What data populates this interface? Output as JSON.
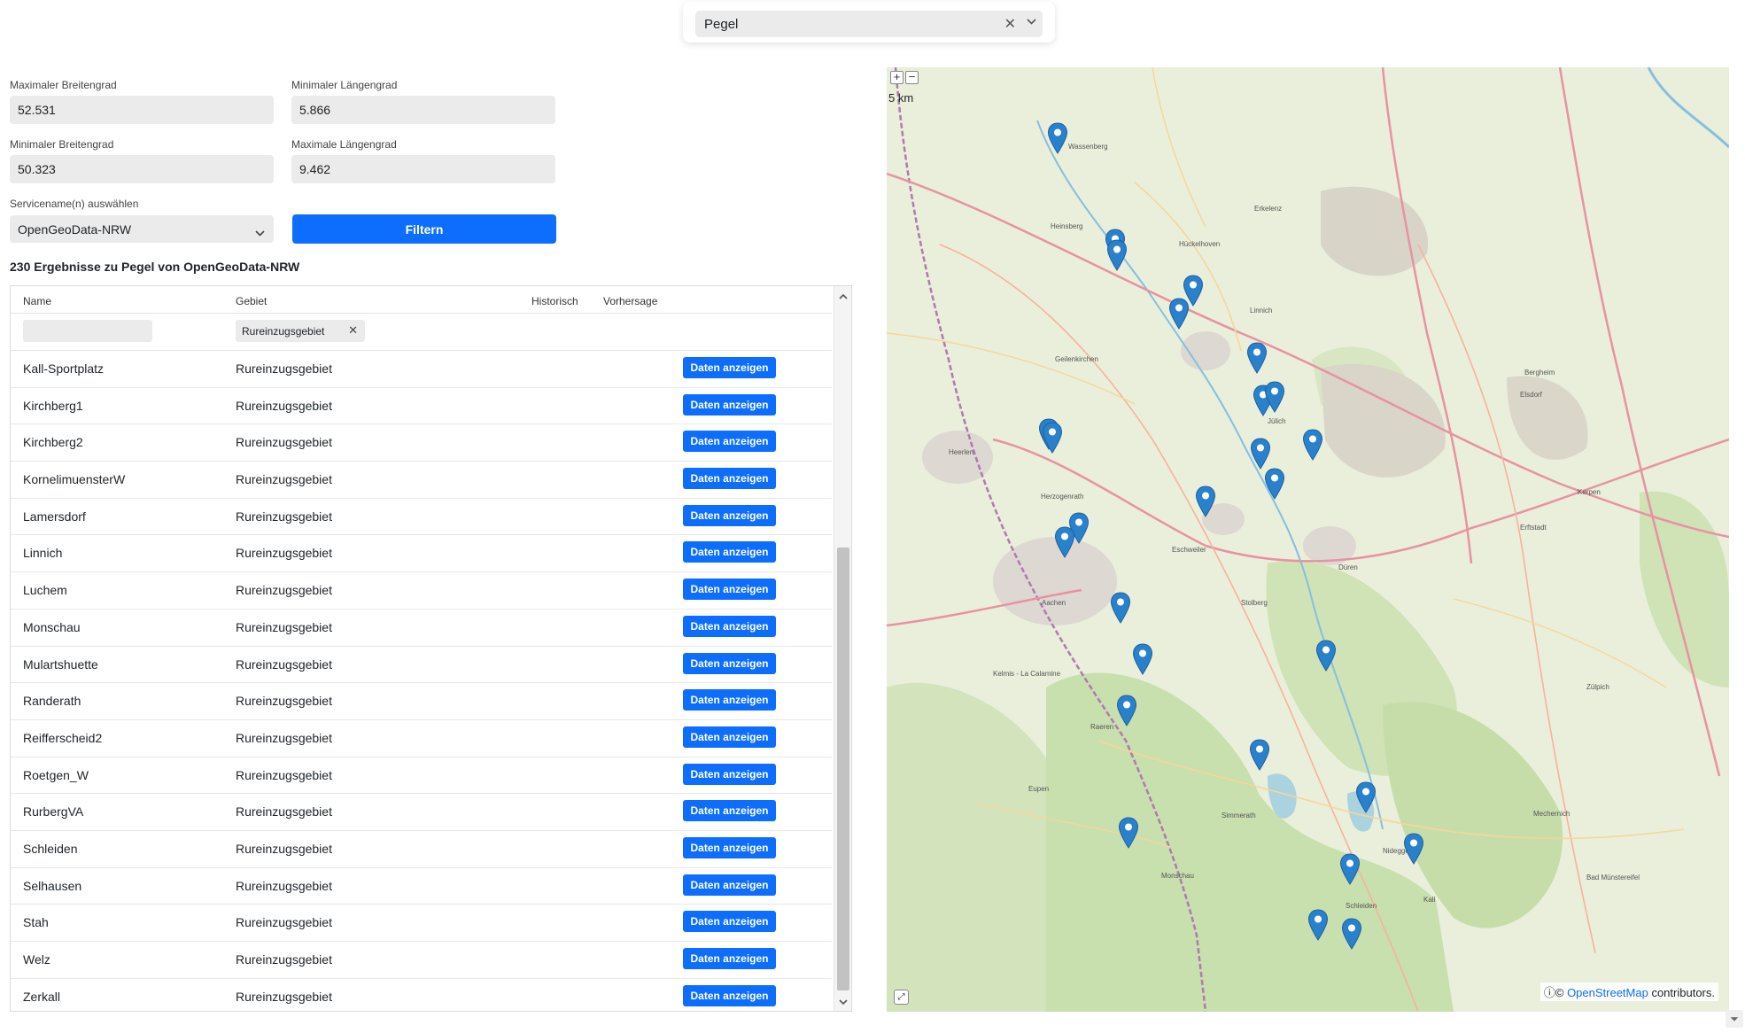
{
  "dataset_select": {
    "value": "Pegel",
    "clear_icon": "close-icon",
    "toggle_icon": "chevron-down-icon"
  },
  "form": {
    "max_lat_label": "Maximaler Breitengrad",
    "max_lat_value": "52.531",
    "min_lon_label": "Minimaler Längengrad",
    "min_lon_value": "5.866",
    "min_lat_label": "Minimaler Breitengrad",
    "min_lat_value": "50.323",
    "max_lon_label": "Maximale Längengrad",
    "max_lon_value": "9.462",
    "service_label": "Servicename(n) auswählen",
    "service_value": "OpenGeoData-NRW",
    "filter_button": "Filtern"
  },
  "results_title": "230 Ergebnisse zu Pegel von OpenGeoData-NRW",
  "table": {
    "headers": {
      "name": "Name",
      "area": "Gebiet",
      "historic": "Historisch",
      "forecast": "Vorhersage"
    },
    "area_filter_tag": "Rureinzugsgebiet",
    "button_label": "Daten anzeigen",
    "rows": [
      {
        "name": "Kall-Sportplatz",
        "area": "Rureinzugsgebiet"
      },
      {
        "name": "Kirchberg1",
        "area": "Rureinzugsgebiet"
      },
      {
        "name": "Kirchberg2",
        "area": "Rureinzugsgebiet"
      },
      {
        "name": "KornelimuensterW",
        "area": "Rureinzugsgebiet"
      },
      {
        "name": "Lamersdorf",
        "area": "Rureinzugsgebiet"
      },
      {
        "name": "Linnich",
        "area": "Rureinzugsgebiet"
      },
      {
        "name": "Luchem",
        "area": "Rureinzugsgebiet"
      },
      {
        "name": "Monschau",
        "area": "Rureinzugsgebiet"
      },
      {
        "name": "Mulartshuette",
        "area": "Rureinzugsgebiet"
      },
      {
        "name": "Randerath",
        "area": "Rureinzugsgebiet"
      },
      {
        "name": "Reifferscheid2",
        "area": "Rureinzugsgebiet"
      },
      {
        "name": "Roetgen_W",
        "area": "Rureinzugsgebiet"
      },
      {
        "name": "RurbergVA",
        "area": "Rureinzugsgebiet"
      },
      {
        "name": "Schleiden",
        "area": "Rureinzugsgebiet"
      },
      {
        "name": "Selhausen",
        "area": "Rureinzugsgebiet"
      },
      {
        "name": "Stah",
        "area": "Rureinzugsgebiet"
      },
      {
        "name": "Welz",
        "area": "Rureinzugsgebiet"
      },
      {
        "name": "Zerkall",
        "area": "Rureinzugsgebiet"
      }
    ]
  },
  "map": {
    "scale": "5 km",
    "zoom_in": "+",
    "zoom_out": "−",
    "attribution_prefix": "ⓘ© ",
    "attribution_link": "OpenStreetMap",
    "attribution_suffix": " contributors.",
    "marker_color": "#2a81cb",
    "place_labels": [
      "Wassenberg",
      "Heinsberg",
      "Geilenkirchen",
      "Jülich",
      "Düren",
      "Aachen",
      "Stolberg",
      "Eschweiler",
      "Herzogenrath",
      "Heerlen",
      "Monschau",
      "Schleiden",
      "Kall",
      "Simmerath",
      "Nideggen",
      "Kerpen",
      "Erftstadt",
      "Zülpich",
      "Mechernich",
      "Bergheim",
      "Elsdorf",
      "Linnich",
      "Hückelhoven",
      "Erkelenz",
      "Bad Münstereifel",
      "Kelmis - La Calamine",
      "Eupen",
      "Raeren"
    ]
  },
  "colors": {
    "primary": "#0d6efd",
    "input_bg": "#ebebeb"
  }
}
